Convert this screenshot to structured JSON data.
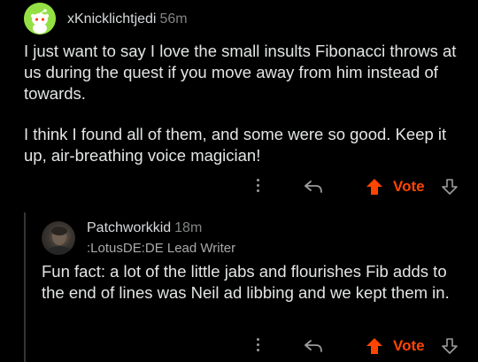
{
  "comments": [
    {
      "author": "xKnicklichtjedi",
      "time": "56m",
      "paragraphs": [
        "I just want to say I love the small insults Fibonacci throws at us during the quest if you move away from him instead of towards.",
        "I think I found all of them, and some were so good. Keep it up, air-breathing voice magician!"
      ],
      "avatar_icon": "snoo-avatar-icon",
      "vote_label": "Vote"
    },
    {
      "author": "Patchworkkid",
      "time": "18m",
      "flair": ":LotusDE:DE Lead Writer",
      "paragraphs": [
        "Fun fact: a lot of the little jabs and flourishes Fib adds to the end of lines was Neil ad libbing and we kept them in."
      ],
      "avatar_icon": "user-photo-avatar-icon",
      "vote_label": "Vote"
    }
  ],
  "colors": {
    "background": "#000000",
    "text": "#e3e5e6",
    "meta": "#818384",
    "upvote_accent": "#ff4500",
    "snoo_avatar_bg": "#94e044",
    "thread_line": "#343536"
  },
  "icons": {
    "more": "more-options-icon",
    "reply": "reply-arrow-icon",
    "upvote": "upvote-arrow-icon",
    "downvote": "downvote-arrow-icon"
  }
}
